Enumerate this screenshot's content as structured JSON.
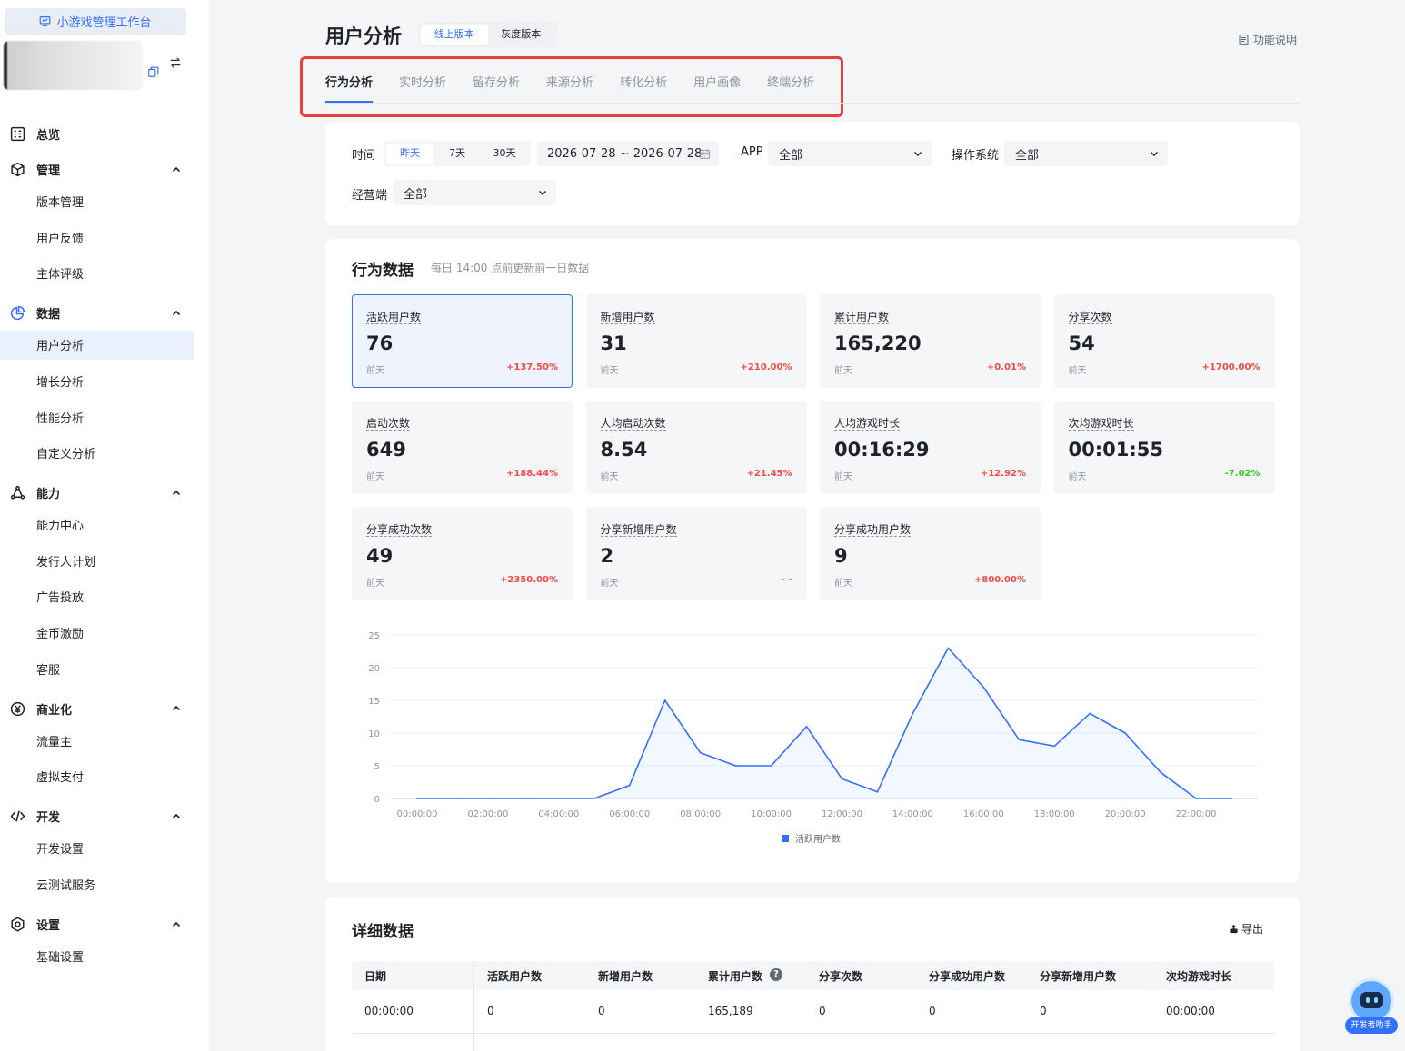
{
  "sidebar": {
    "workspace_label": "小游戏管理工作台",
    "groups": [
      {
        "label": "总览",
        "icon": "dashboard-icon",
        "items": []
      },
      {
        "label": "管理",
        "icon": "cube-icon",
        "items": [
          "版本管理",
          "用户反馈",
          "主体评级"
        ]
      },
      {
        "label": "数据",
        "icon": "pie-chart-icon",
        "items": [
          "用户分析",
          "增长分析",
          "性能分析",
          "自定义分析"
        ]
      },
      {
        "label": "能力",
        "icon": "ability-icon",
        "items": [
          "能力中心",
          "发行人计划",
          "广告投放",
          "金币激励",
          "客服"
        ]
      },
      {
        "label": "商业化",
        "icon": "yuan-icon",
        "items": [
          "流量主",
          "虚拟支付"
        ]
      },
      {
        "label": "开发",
        "icon": "code-icon",
        "items": [
          "开发设置",
          "云测试服务"
        ]
      },
      {
        "label": "设置",
        "icon": "settings-icon",
        "items": [
          "基础设置"
        ]
      }
    ],
    "active_item": "用户分析"
  },
  "header": {
    "title": "用户分析",
    "versions": [
      "线上版本",
      "灰度版本"
    ],
    "active_version": "线上版本",
    "help_label": "功能说明"
  },
  "tabs": [
    "行为分析",
    "实时分析",
    "留存分析",
    "来源分析",
    "转化分析",
    "用户画像",
    "终端分析"
  ],
  "active_tab": "行为分析",
  "filters": {
    "time_label": "时间",
    "time_options": [
      "昨天",
      "7天",
      "30天"
    ],
    "time_selected": "昨天",
    "date_range": "2026-07-28 ~ 2026-07-28",
    "app_label": "APP",
    "app_value": "全部",
    "os_label": "操作系统",
    "os_value": "全部",
    "channel_label": "经营端",
    "channel_value": "全部"
  },
  "behavior": {
    "title": "行为数据",
    "subtitle": "每日 14:00 点前更新前一日数据",
    "compare_label": "前天",
    "metrics": [
      {
        "name": "活跃用户数",
        "value": "76",
        "change": "+137.50%",
        "trend": "up",
        "selected": true
      },
      {
        "name": "新增用户数",
        "value": "31",
        "change": "+210.00%",
        "trend": "up"
      },
      {
        "name": "累计用户数",
        "value": "165,220",
        "change": "+0.01%",
        "trend": "up"
      },
      {
        "name": "分享次数",
        "value": "54",
        "change": "+1700.00%",
        "trend": "up"
      },
      {
        "name": "启动次数",
        "value": "649",
        "change": "+188.44%",
        "trend": "up"
      },
      {
        "name": "人均启动次数",
        "value": "8.54",
        "change": "+21.45%",
        "trend": "up"
      },
      {
        "name": "人均游戏时长",
        "value": "00:16:29",
        "change": "+12.92%",
        "trend": "up"
      },
      {
        "name": "次均游戏时长",
        "value": "00:01:55",
        "change": "-7.02%",
        "trend": "down"
      },
      {
        "name": "分享成功次数",
        "value": "49",
        "change": "+2350.00%",
        "trend": "up"
      },
      {
        "name": "分享新增用户数",
        "value": "2",
        "change": "- -",
        "trend": "flat"
      },
      {
        "name": "分享成功用户数",
        "value": "9",
        "change": "+800.00%",
        "trend": "up"
      }
    ]
  },
  "chart_data": {
    "type": "line",
    "x": [
      "00:00:00",
      "01:00:00",
      "02:00:00",
      "03:00:00",
      "04:00:00",
      "05:00:00",
      "06:00:00",
      "07:00:00",
      "08:00:00",
      "09:00:00",
      "10:00:00",
      "11:00:00",
      "12:00:00",
      "13:00:00",
      "14:00:00",
      "15:00:00",
      "16:00:00",
      "17:00:00",
      "18:00:00",
      "19:00:00",
      "20:00:00",
      "21:00:00",
      "22:00:00",
      "23:00:00"
    ],
    "x_tick_labels": [
      "00:00:00",
      "02:00:00",
      "04:00:00",
      "06:00:00",
      "08:00:00",
      "10:00:00",
      "12:00:00",
      "14:00:00",
      "16:00:00",
      "18:00:00",
      "20:00:00",
      "22:00:00"
    ],
    "series": [
      {
        "name": "活跃用户数",
        "values": [
          0,
          0,
          0,
          0,
          0,
          0,
          2,
          15,
          7,
          5,
          5,
          11,
          3,
          1,
          13,
          23,
          17,
          9,
          8,
          13,
          10,
          4,
          0,
          0
        ]
      }
    ],
    "ylim": [
      0,
      25
    ],
    "y_ticks": [
      0,
      5,
      10,
      15,
      20,
      25
    ],
    "grid": true,
    "legend": "bottom-center",
    "color": "#3370ff"
  },
  "detail": {
    "title": "详细数据",
    "export_label": "导出",
    "columns": [
      "日期",
      "活跃用户数",
      "新增用户数",
      "累计用户数",
      "分享次数",
      "分享成功用户数",
      "分享新增用户数",
      "次均游戏时长"
    ],
    "rows": [
      [
        "00:00:00",
        "0",
        "0",
        "165,189",
        "0",
        "0",
        "0",
        "00:00:00"
      ]
    ]
  },
  "assistant_label": "开发者助手",
  "colors": {
    "accent": "#3370ff",
    "up": "#f54a45",
    "down": "#34c724",
    "highlight_box": "#e8403f"
  }
}
